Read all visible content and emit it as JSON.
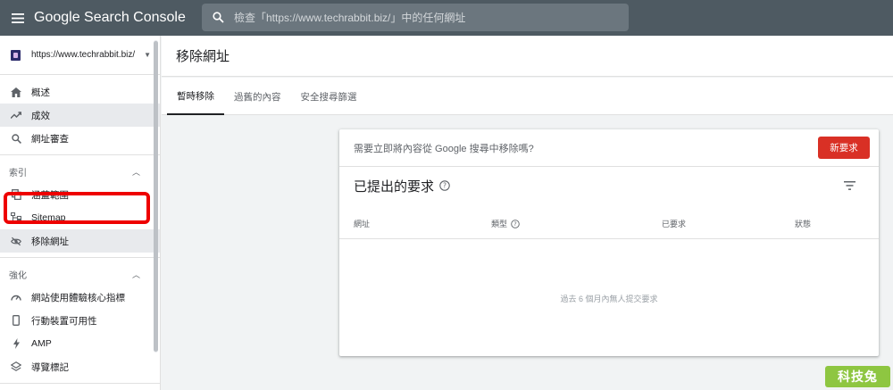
{
  "topbar": {
    "app_title": "Google Search Console",
    "search_placeholder": "檢查「https://www.techrabbit.biz/」中的任何網址"
  },
  "sidebar": {
    "property": "https://www.techrabbit.biz/",
    "primary_items": [
      {
        "label": "概述",
        "icon": "home-icon"
      },
      {
        "label": "成效",
        "icon": "trending-up-icon",
        "active": true
      },
      {
        "label": "網址審查",
        "icon": "search-icon"
      }
    ],
    "index_section": {
      "label": "索引",
      "items": [
        {
          "label": "涵蓋範圍",
          "icon": "copy-icon"
        },
        {
          "label": "Sitemap",
          "icon": "sitemap-icon"
        },
        {
          "label": "移除網址",
          "icon": "eye-off-icon",
          "highlighted": true
        }
      ]
    },
    "enhance_section": {
      "label": "強化",
      "items": [
        {
          "label": "網站使用體驗核心指標",
          "icon": "gauge-icon"
        },
        {
          "label": "行動裝置可用性",
          "icon": "phone-icon"
        },
        {
          "label": "AMP",
          "icon": "bolt-icon"
        },
        {
          "label": "導覽標記",
          "icon": "layers-icon"
        }
      ]
    }
  },
  "main": {
    "page_title": "移除網址",
    "tabs": [
      "暫時移除",
      "過舊的內容",
      "安全搜尋篩選"
    ],
    "active_tab": 0,
    "card": {
      "question": "需要立即將內容從 Google 搜尋中移除嗎?",
      "new_request_label": "新要求",
      "submitted_title": "已提出的要求",
      "columns": [
        "網址",
        "類型",
        "已要求",
        "狀態"
      ],
      "empty_message": "過去 6 個月內無人提交要求"
    }
  },
  "watermark": "科技兔",
  "colors": {
    "topbar": "#4e5a62",
    "accent_red": "#d93025",
    "highlight": "#ee0000",
    "watermark_bg": "#8ec641"
  }
}
